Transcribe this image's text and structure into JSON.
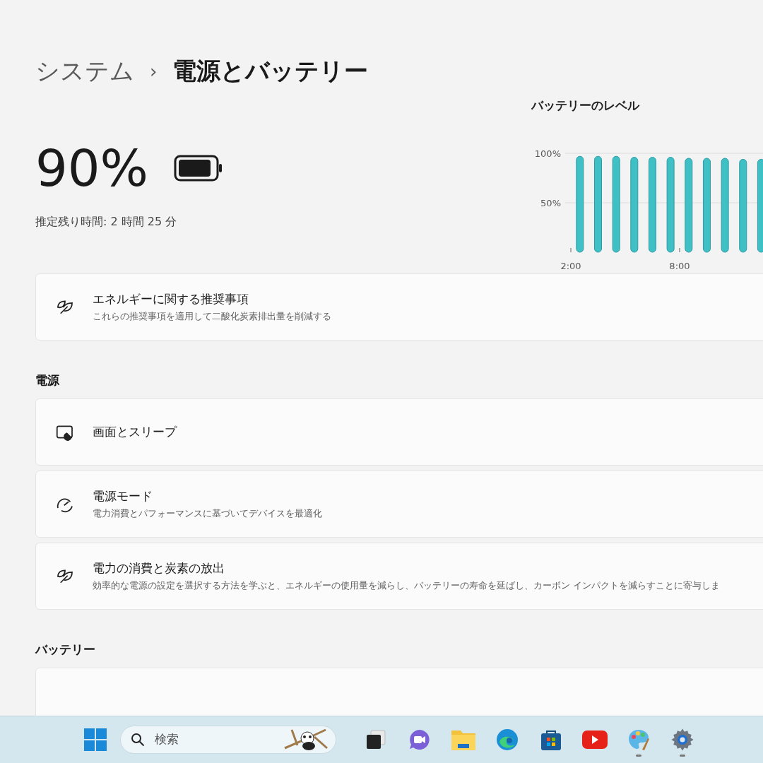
{
  "breadcrumb": {
    "parent": "システム",
    "separator": "›",
    "current": "電源とバッテリー"
  },
  "battery": {
    "percent": "90%",
    "level": 0.9,
    "remaining": "推定残り時間: 2 時間 25 分"
  },
  "battery_chart": {
    "title": "バッテリーのレベル",
    "chart_data": {
      "type": "bar",
      "x": [
        2.5,
        3.5,
        4.5,
        5.5,
        6.5,
        7.5,
        8.5,
        9.5,
        10.5,
        11.5,
        12.5
      ],
      "values": [
        97,
        97,
        97,
        96,
        96,
        96,
        95,
        95,
        95,
        94,
        94
      ],
      "ylim": [
        0,
        100
      ],
      "yticks": [
        {
          "value": 50,
          "label": "50%"
        },
        {
          "value": 100,
          "label": "100%"
        }
      ],
      "xticks": [
        {
          "value": 2,
          "label": "2:00"
        },
        {
          "value": 8,
          "label": "8:00"
        }
      ],
      "xlim": [
        2,
        12.6
      ]
    }
  },
  "recommendation": {
    "kind": "leaf",
    "title": "エネルギーに関する推奨事項",
    "description": "これらの推奨事項を適用して二酸化炭素排出量を削減する"
  },
  "power_section": {
    "heading": "電源",
    "cards": [
      {
        "kind": "screen",
        "title": "画面とスリープ"
      },
      {
        "kind": "gauge",
        "title": "電源モード",
        "description": "電力消費とパフォーマンスに基づいてデバイスを最適化"
      },
      {
        "kind": "leaf",
        "title": "電力の消費と炭素の放出",
        "description": "効率的な電源の設定を選択する方法を学ぶと、エネルギーの使用量を減らし、バッテリーの寿命を延ばし、カーボン インパクトを減らすことに寄与しま"
      }
    ]
  },
  "battery_section": {
    "heading": "バッテリー"
  },
  "taskbar": {
    "search_placeholder": "検索",
    "apps": [
      {
        "kind": "taskview",
        "running": false
      },
      {
        "kind": "chat",
        "running": false
      },
      {
        "kind": "folder",
        "running": false
      },
      {
        "kind": "browser",
        "running": false
      },
      {
        "kind": "store",
        "running": false
      },
      {
        "kind": "video",
        "running": false
      },
      {
        "kind": "paint",
        "running": true
      },
      {
        "kind": "settings",
        "running": true
      }
    ]
  }
}
